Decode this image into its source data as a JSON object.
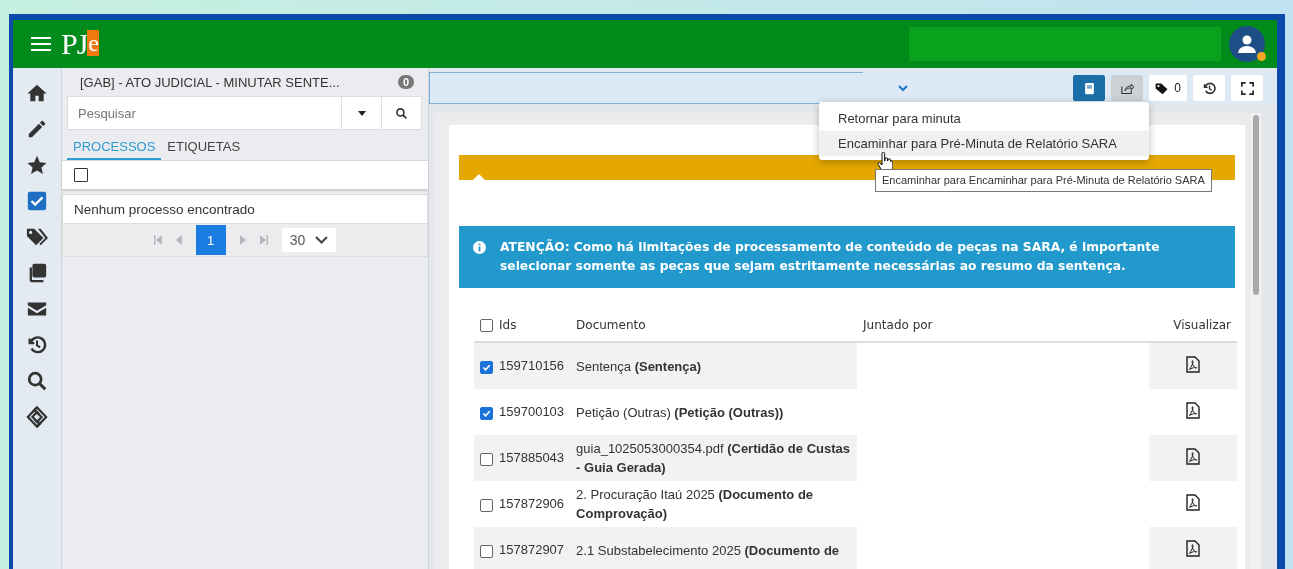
{
  "header": {
    "logo_main": "PJ",
    "logo_accent": "e"
  },
  "rail": [
    {
      "kind": "home"
    },
    {
      "kind": "edit"
    },
    {
      "kind": "star"
    },
    {
      "kind": "tasks"
    },
    {
      "kind": "tags"
    },
    {
      "kind": "copies"
    },
    {
      "kind": "mail"
    },
    {
      "kind": "history"
    },
    {
      "kind": "search"
    },
    {
      "kind": "link"
    }
  ],
  "task_panel": {
    "title": "[GAB] - ATO JUDICIAL - MINUTAR SENTE...",
    "count": "0",
    "search": {
      "placeholder": "Pesquisar"
    },
    "tabs": [
      {
        "label": "PROCESSOS",
        "selected": true
      },
      {
        "label": "ETIQUETAS",
        "selected": false
      }
    ],
    "select_all": {
      "checked": false
    },
    "empty_message": "Nenhum processo encontrado",
    "pagination": {
      "pages": [
        {
          "label": "1",
          "selected": true
        }
      ],
      "page_size": "30"
    }
  },
  "toolbar": {
    "buttons": [
      {
        "kind": "book",
        "selected": true
      },
      {
        "kind": "share",
        "selected": false,
        "hovered": true
      },
      {
        "kind": "tags",
        "selected": false,
        "count": "0"
      },
      {
        "kind": "history",
        "selected": false
      },
      {
        "kind": "expand",
        "selected": false
      }
    ]
  },
  "dropdown_menu": {
    "items": [
      {
        "label": "Retornar para minuta",
        "selected": false
      },
      {
        "label": "Encaminhar para Pré-Minuta de Relatório SARA",
        "selected": true
      }
    ]
  },
  "tooltip": "Encaminhar para Encaminhar para Pré-Minuta de Relatório SARA",
  "alert": "ATENÇÃO: Como há limitações de processamento de conteúdo de peças na SARA, é importante selecionar somente as peças que sejam estritamente necessárias ao resumo da sentença.",
  "documents": {
    "select_all": {
      "checked": false
    },
    "columns": [
      "Ids",
      "Documento",
      "Juntado por",
      "Visualizar"
    ],
    "rows": [
      {
        "id": "159710156",
        "document": "Sentença **(Sentença)**",
        "checked": true
      },
      {
        "id": "159700103",
        "document": "Petição (Outras) **(Petição (Outras))**",
        "checked": true
      },
      {
        "id": "157885043",
        "document": "guia_1025053000354.pdf **(Certidão de Custas - Guia Gerada)**",
        "checked": false
      },
      {
        "id": "157872906",
        "document": "2. Procuração Itaú 2025 **(Documento de Comprovação)**",
        "checked": false
      },
      {
        "id": "157872907",
        "document": "2.1 Substabelecimento 2025 **(Documento de**",
        "checked": false
      }
    ]
  }
}
